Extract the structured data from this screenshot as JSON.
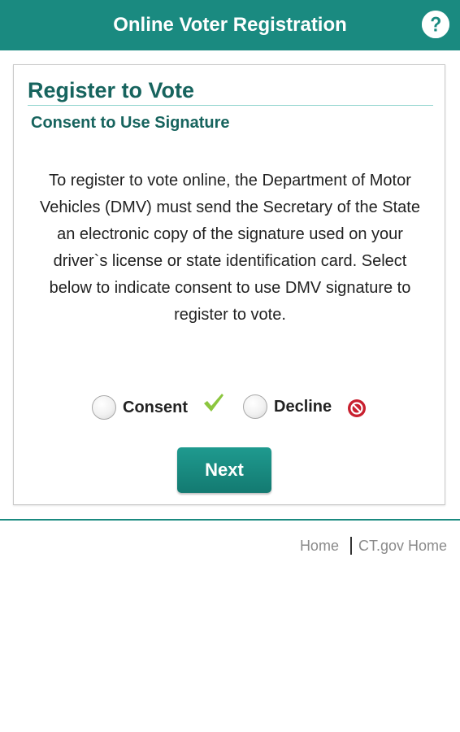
{
  "header": {
    "title": "Online Voter Registration",
    "help_icon": "question-circle-icon"
  },
  "card": {
    "title": "Register to Vote",
    "subtitle": "Consent to Use Signature",
    "body": "To register to vote online, the Department of Motor Vehicles (DMV) must send the Secretary of the State an electronic copy of the signature used on your driver`s license or state identification card. Select below to indicate consent to use DMV signature to register to vote."
  },
  "options": [
    {
      "label": "Consent",
      "icon": "checkmark-icon",
      "selected": false
    },
    {
      "label": "Decline",
      "icon": "no-sign-icon",
      "selected": false
    }
  ],
  "next_button": {
    "label": "Next"
  },
  "footer": {
    "links": [
      "Home",
      "CT.gov Home"
    ]
  },
  "colors": {
    "brand_teal": "#1a8a80",
    "heading_teal": "#17645e",
    "check_green": "#8cc63f",
    "decline_red": "#c8202f"
  }
}
